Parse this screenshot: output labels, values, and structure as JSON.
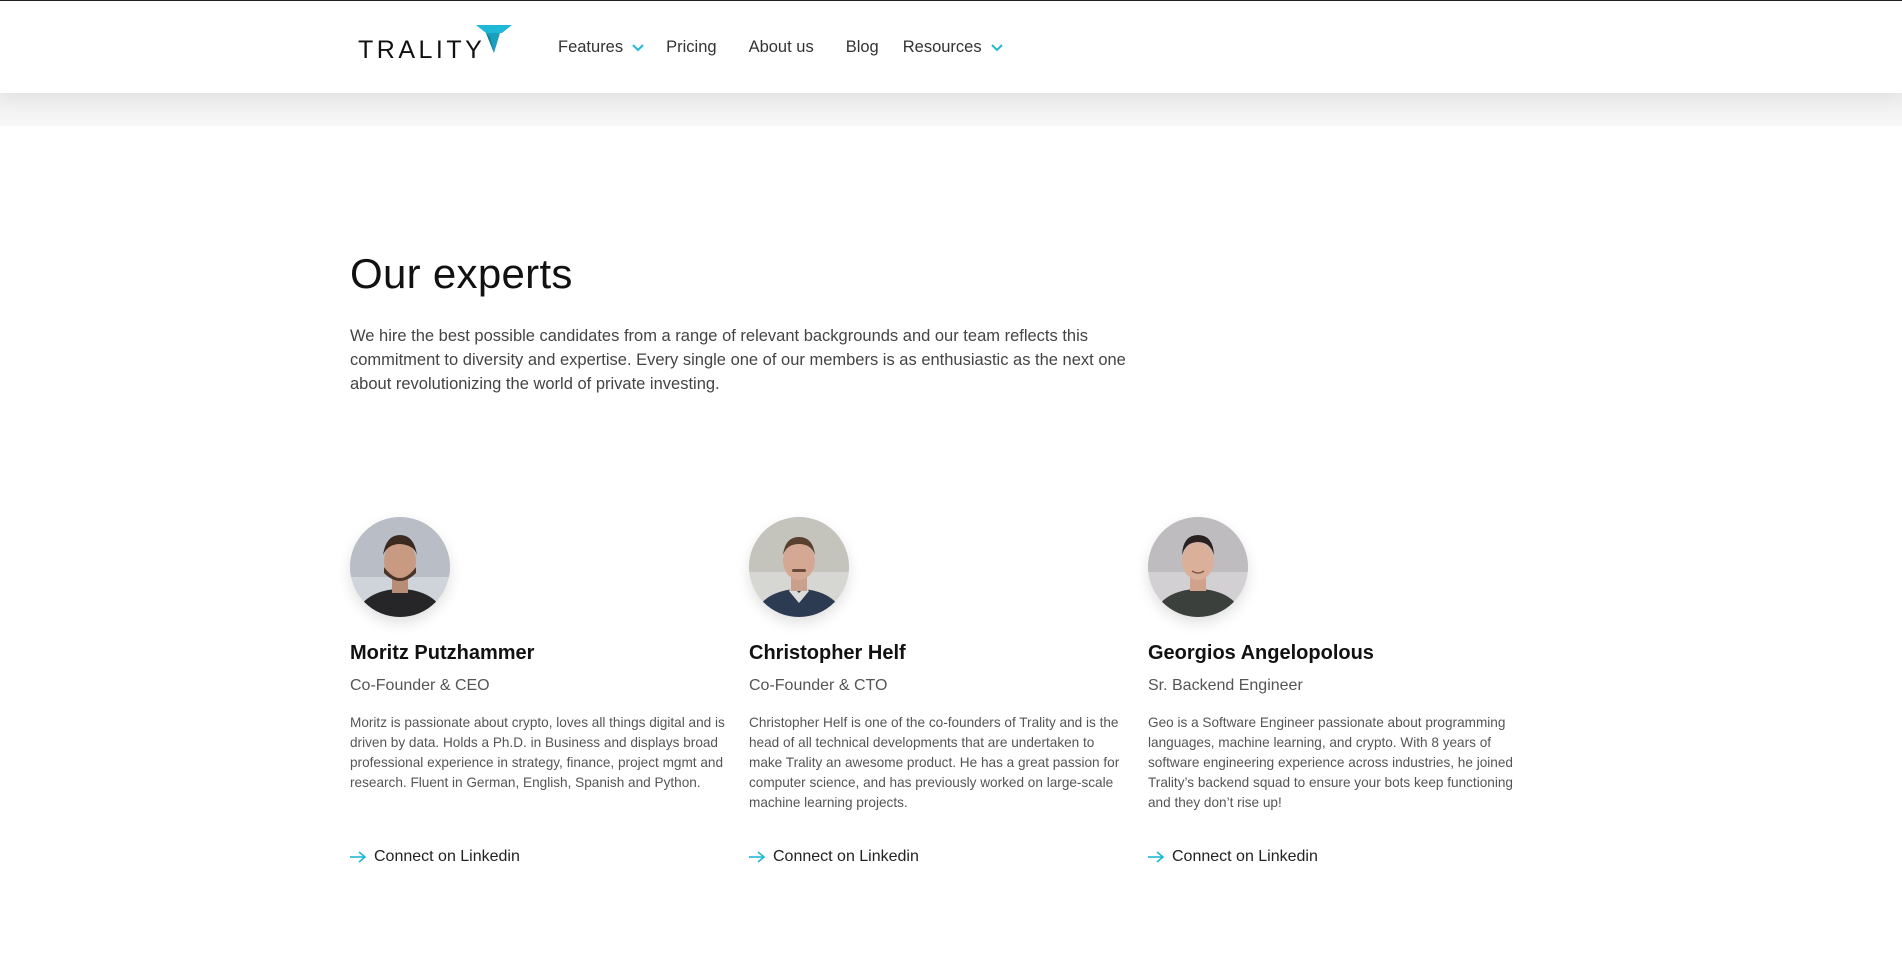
{
  "brand": {
    "name": "TRALITY",
    "accent_color": "#1fb8d6"
  },
  "nav": {
    "items": [
      {
        "label": "Features",
        "has_dropdown": true
      },
      {
        "label": "Pricing",
        "has_dropdown": false
      },
      {
        "label": "About us",
        "has_dropdown": false
      },
      {
        "label": "Blog",
        "has_dropdown": false
      },
      {
        "label": "Resources",
        "has_dropdown": true
      }
    ]
  },
  "experts": {
    "title": "Our experts",
    "intro": "We hire the best possible candidates from a range of relevant backgrounds and our team reflects this commitment to diversity and expertise. Every single one of our members is as enthusiastic as the next one about revolutionizing the world of private investing.",
    "members": [
      {
        "name": "Moritz Putzhammer",
        "role": "Co-Founder & CEO",
        "bio": "Moritz is passionate about crypto, loves all things digital and is driven by data. Holds a Ph.D. in Business and displays broad professional experience in strategy, finance, project mgmt and research. Fluent in German, English, Spanish and Python.",
        "link_label": "Connect on Linkedin"
      },
      {
        "name": "Christopher Helf",
        "role": "Co-Founder & CTO",
        "bio": "Christopher Helf is one of the co-founders of Trality and is the head of all technical developments that are undertaken to make Trality an awesome product. He has a great passion for computer science, and has previously worked on large-scale machine learning projects.",
        "link_label": "Connect on Linkedin"
      },
      {
        "name": "Georgios Angelopolous",
        "role": "Sr. Backend Engineer",
        "bio": "Geo is a Software Engineer passionate about programming languages, machine learning, and crypto. With 8 years of software engineering experience across industries, he joined Trality’s backend squad to ensure your bots keep functioning and they don’t rise up!",
        "link_label": "Connect on Linkedin"
      }
    ]
  }
}
